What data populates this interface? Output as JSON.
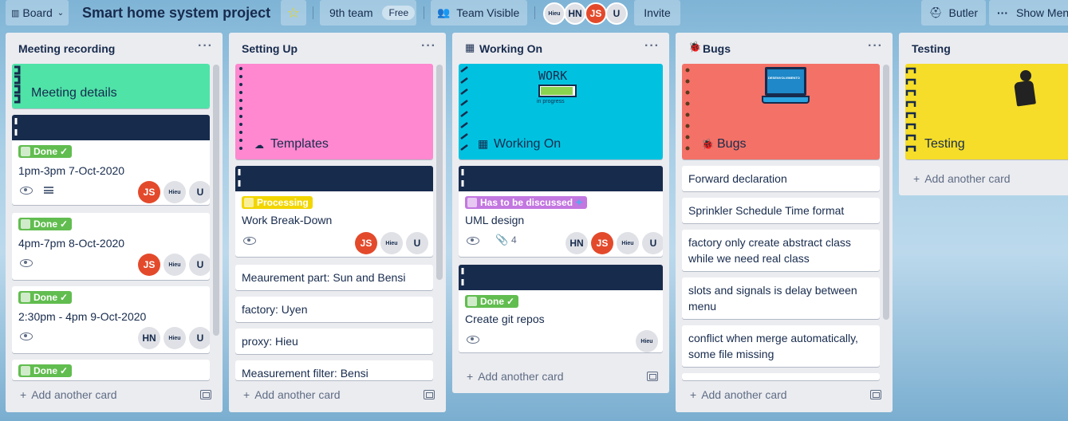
{
  "header": {
    "board_label": "Board",
    "board_title": "Smart home system project",
    "team_name": "9th team",
    "team_plan": "Free",
    "visibility": "Team Visible",
    "members": [
      {
        "initials": "Hieu"
      },
      {
        "initials": "HN"
      },
      {
        "initials": "JS"
      },
      {
        "initials": "U"
      }
    ],
    "invite": "Invite",
    "butler": "Butler",
    "show_menu": "Show Menu"
  },
  "add_card": "Add another card",
  "lists": [
    {
      "title": "Meeting recording",
      "cards": [
        {
          "cover_title": "Meeting details"
        },
        {
          "label": "Done",
          "title": "1pm-3pm 7-Oct-2020",
          "members": [
            "JS",
            "Hieu",
            "U"
          ]
        },
        {
          "label": "Done",
          "title": "4pm-7pm 8-Oct-2020",
          "members": [
            "JS",
            "Hieu",
            "U"
          ]
        },
        {
          "label": "Done",
          "title": "2:30pm - 4pm 9-Oct-2020",
          "members": [
            "HN",
            "Hieu",
            "U"
          ]
        },
        {
          "label": "Done"
        }
      ]
    },
    {
      "title": "Setting Up",
      "cards": [
        {
          "cover_title": "Templates"
        },
        {
          "label": "Processing",
          "title": "Work Break-Down",
          "members": [
            "JS",
            "Hieu",
            "U"
          ]
        },
        {
          "title": "Meaurement part: Sun and Bensi"
        },
        {
          "title": "factory: Uyen"
        },
        {
          "title": "proxy: Hieu"
        },
        {
          "title": "Measurement filter: Bensi"
        }
      ]
    },
    {
      "title": "Working On",
      "cards": [
        {
          "cover_title": "Working On",
          "cover_art_text": "WORK",
          "cover_art_sub": "in progress"
        },
        {
          "label": "Has to be discussed",
          "title": "UML design",
          "attachments": "4",
          "members": [
            "HN",
            "JS",
            "Hieu",
            "U"
          ]
        },
        {
          "label": "Done",
          "title": "Create git repos",
          "members": [
            "Hieu"
          ]
        }
      ]
    },
    {
      "title": "Bugs",
      "cards": [
        {
          "cover_title": "Bugs",
          "cover_art_text": "DESENVOLVIMENTO"
        },
        {
          "title": "Forward declaration"
        },
        {
          "title": "Sprinkler Schedule Time format"
        },
        {
          "title": "factory only create abstract class while we need real class"
        },
        {
          "title": "slots and signals is delay between menu"
        },
        {
          "title": "conflict when merge automatically, some file missing"
        }
      ]
    },
    {
      "title": "Testing",
      "cards": [
        {
          "cover_title": "Testing"
        }
      ]
    }
  ],
  "colors": {
    "done": "#61bd4f",
    "processing": "#f2d600",
    "discuss": "#c377e0",
    "navy": "#172b4d",
    "mint": "#4fe3a8",
    "pink": "#ff88d0",
    "cyan": "#00c2e0",
    "salmon": "#f47167",
    "yellow": "#f5dd29"
  }
}
